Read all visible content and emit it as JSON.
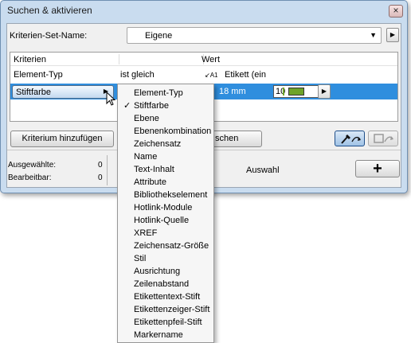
{
  "window": {
    "title": "Suchen & aktivieren",
    "close_glyph": "×"
  },
  "criteria_set": {
    "label": "Kriterien-Set-Name:",
    "value": "Eigene",
    "dropdown_glyph": "▼",
    "next_glyph": "▶"
  },
  "grid": {
    "headers": {
      "criteria": "Kriterien",
      "value": "Wert"
    },
    "rows": [
      {
        "criterion": "Element-Typ",
        "operator": "ist gleich",
        "icon_text": "A1",
        "value": "Etikett (ein"
      },
      {
        "criterion": "Stiftfarbe",
        "arrow_glyph": "▶",
        "value": "18 mm",
        "pen_number": "10",
        "pen_color": "#6ea329",
        "next_glyph": "▶"
      }
    ]
  },
  "buttons": {
    "add_criterion": "Kriterium hinzufügen",
    "delete_partial": "schen",
    "select_all_glyph": "+"
  },
  "status": {
    "selected_label": "Ausgewählte:",
    "selected_count": "0",
    "editable_label": "Bearbeitbar:",
    "editable_count": "0",
    "selection_label": "Auswahl"
  },
  "menu": {
    "checked_glyph": "✓",
    "items": [
      {
        "label": "Element-Typ",
        "checked": false
      },
      {
        "label": "Stiftfarbe",
        "checked": true
      },
      {
        "label": "Ebene",
        "checked": false
      },
      {
        "label": "Ebenenkombination",
        "checked": false
      },
      {
        "label": "Zeichensatz",
        "checked": false
      },
      {
        "label": "Name",
        "checked": false
      },
      {
        "label": "Text-Inhalt",
        "checked": false
      },
      {
        "label": "Attribute",
        "checked": false
      },
      {
        "label": "Bibliothekselement",
        "checked": false
      },
      {
        "label": "Hotlink-Module",
        "checked": false
      },
      {
        "label": "Hotlink-Quelle",
        "checked": false
      },
      {
        "label": "XREF",
        "checked": false
      },
      {
        "label": "Zeichensatz-Größe",
        "checked": false
      },
      {
        "label": "Stil",
        "checked": false
      },
      {
        "label": "Ausrichtung",
        "checked": false
      },
      {
        "label": "Zeilenabstand",
        "checked": false
      },
      {
        "label": "Etikettentext-Stift",
        "checked": false
      },
      {
        "label": "Etikettenzeiger-Stift",
        "checked": false
      },
      {
        "label": "Etikettenpfeil-Stift",
        "checked": false
      },
      {
        "label": "Markername",
        "checked": false
      }
    ]
  },
  "colors": {
    "selection": "#2f8ede",
    "window_frame": "#c9dcef",
    "pen_green": "#6ea329"
  }
}
